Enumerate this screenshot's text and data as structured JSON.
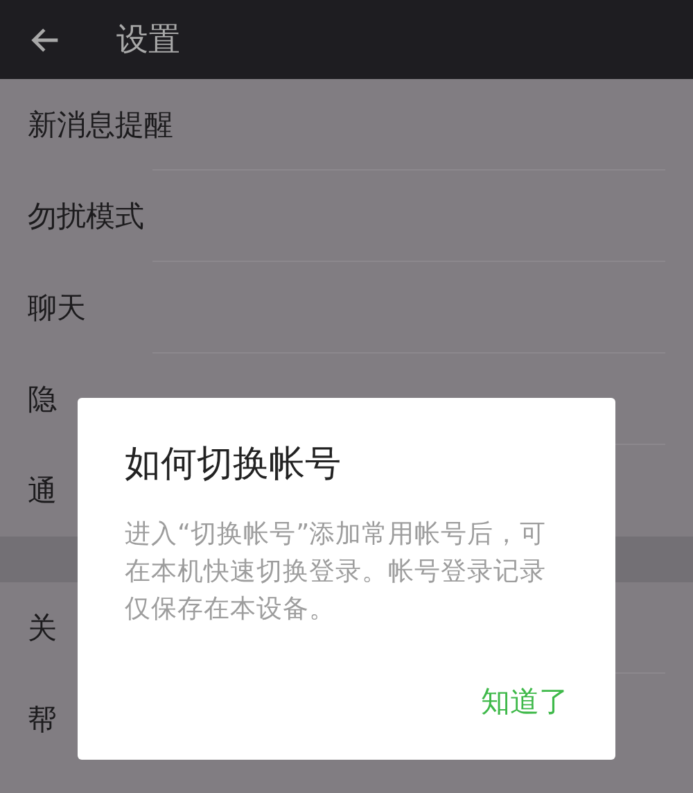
{
  "header": {
    "title": "设置"
  },
  "sections": [
    {
      "items": [
        "新消息提醒",
        "勿扰模式",
        "聊天",
        "隐",
        "通"
      ]
    },
    {
      "items": [
        "关",
        "帮"
      ]
    }
  ],
  "dialog": {
    "title": "如何切换帐号",
    "message": "进入“切换帐号”添加常用帐号后，可在本机快速切换登录。帐号登录记录仅保存在本设备。",
    "button": "知道了"
  }
}
